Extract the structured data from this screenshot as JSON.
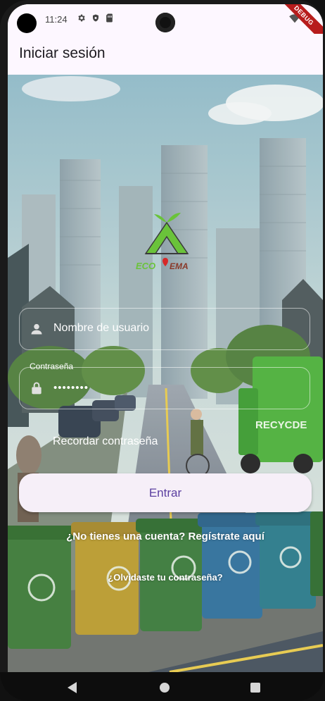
{
  "status_bar": {
    "time": "11:24",
    "icons": [
      "gear-icon",
      "shield-icon",
      "sim-card-icon",
      "wifi-icon"
    ],
    "debug_label": "DEBUG"
  },
  "app_bar": {
    "title": "Iniciar sesión"
  },
  "logo": {
    "text_left": "ECO",
    "text_right": "EMA"
  },
  "form": {
    "username": {
      "placeholder": "Nombre de usuario",
      "icon": "person-icon"
    },
    "password": {
      "label": "Contraseña",
      "value": "••••••••",
      "icon": "lock-icon"
    },
    "remember_label": "Recordar contraseña",
    "submit_label": "Entrar",
    "register_link": "¿No tienes una cuenta? Regístrate aquí",
    "forgot_link": "¿Olvidaste tu contraseña?"
  },
  "background_text": {
    "truck_label": "RECYCDE"
  },
  "colors": {
    "accent": "#5b3fa0",
    "button_bg": "#f6eff8",
    "surface": "#fdf7ff",
    "logo_green": "#6ac33a",
    "logo_red": "#d62828"
  },
  "nav_bar": {
    "buttons": [
      "back-icon",
      "home-icon",
      "recent-apps-icon"
    ]
  }
}
